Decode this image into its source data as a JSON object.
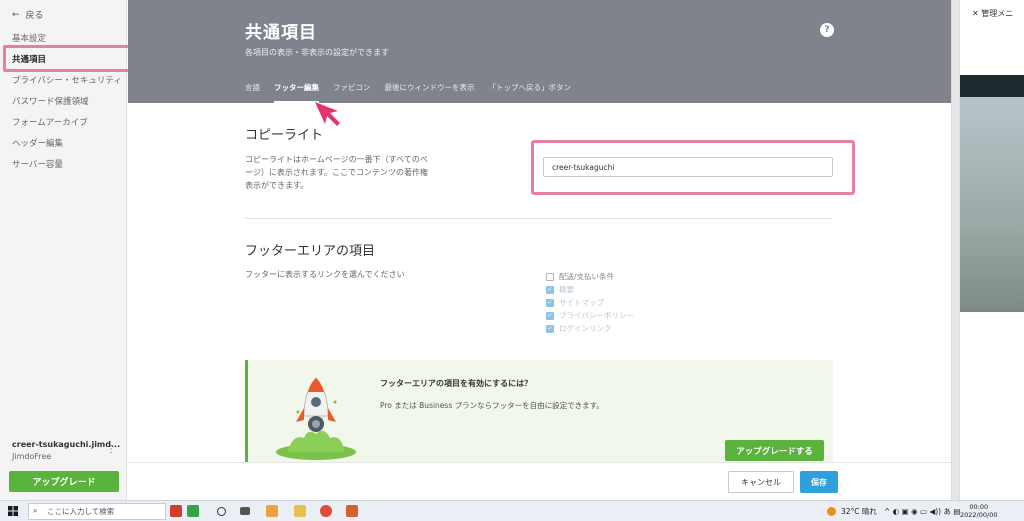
{
  "sidebar": {
    "back_label": "戻る",
    "items": [
      {
        "label": "基本設定",
        "active": false
      },
      {
        "label": "共通項目",
        "active": true
      },
      {
        "label": "プライバシー・セキュリティ",
        "active": false
      },
      {
        "label": "パスワード保護領域",
        "active": false
      },
      {
        "label": "フォームアーカイブ",
        "active": false
      },
      {
        "label": "ヘッダー編集",
        "active": false
      },
      {
        "label": "サーバー容量",
        "active": false
      }
    ],
    "account_name": "creer-tsukaguchi.jimd...",
    "plan": "JimdoFree",
    "upgrade_label": "アップグレード"
  },
  "header": {
    "title": "共通項目",
    "subtitle": "各項目の表示・非表示の設定ができます",
    "help": "?",
    "tabs": [
      {
        "label": "言語",
        "active": false
      },
      {
        "label": "フッター編集",
        "active": true
      },
      {
        "label": "ファビコン",
        "active": false
      },
      {
        "label": "最後にウィンドウーを表示",
        "active": false
      },
      {
        "label": "「トップへ戻る」ボタン",
        "active": false
      }
    ]
  },
  "copyright": {
    "title": "コピーライト",
    "description": "コピーライトはホームページの一番下（すべてのページ）に表示されます。ここでコンテンツの著作権表示ができます。",
    "input_value": "creer-tsukaguchi"
  },
  "footer_area": {
    "title": "フッターエリアの項目",
    "description": "フッターに表示するリンクを選んでください",
    "checkboxes": [
      {
        "label": "配送/支払い条件",
        "checked": false
      },
      {
        "label": "概要",
        "checked": true
      },
      {
        "label": "サイトマップ",
        "checked": true
      },
      {
        "label": "プライバシーポリシー",
        "checked": true
      },
      {
        "label": "ログインリンク",
        "checked": true
      }
    ]
  },
  "promo": {
    "title": "フッターエリアの項目を有効にするには？",
    "text": "Pro または Business プランならフッターを自由に設定できます。",
    "button": "アップグレードする"
  },
  "actions": {
    "cancel": "キャンセル",
    "save": "保存"
  },
  "right_panel": {
    "title": "管理メニ"
  },
  "taskbar": {
    "search_placeholder": "ここに入力して検索",
    "weather": "32°C 晴れ",
    "time": "00:00",
    "date": "2022/00/00"
  },
  "colors": {
    "header_bg": "#80838c",
    "accent_green": "#5ab33c",
    "save_blue": "#2ea0dd",
    "highlight_pink": "#e480a8"
  }
}
